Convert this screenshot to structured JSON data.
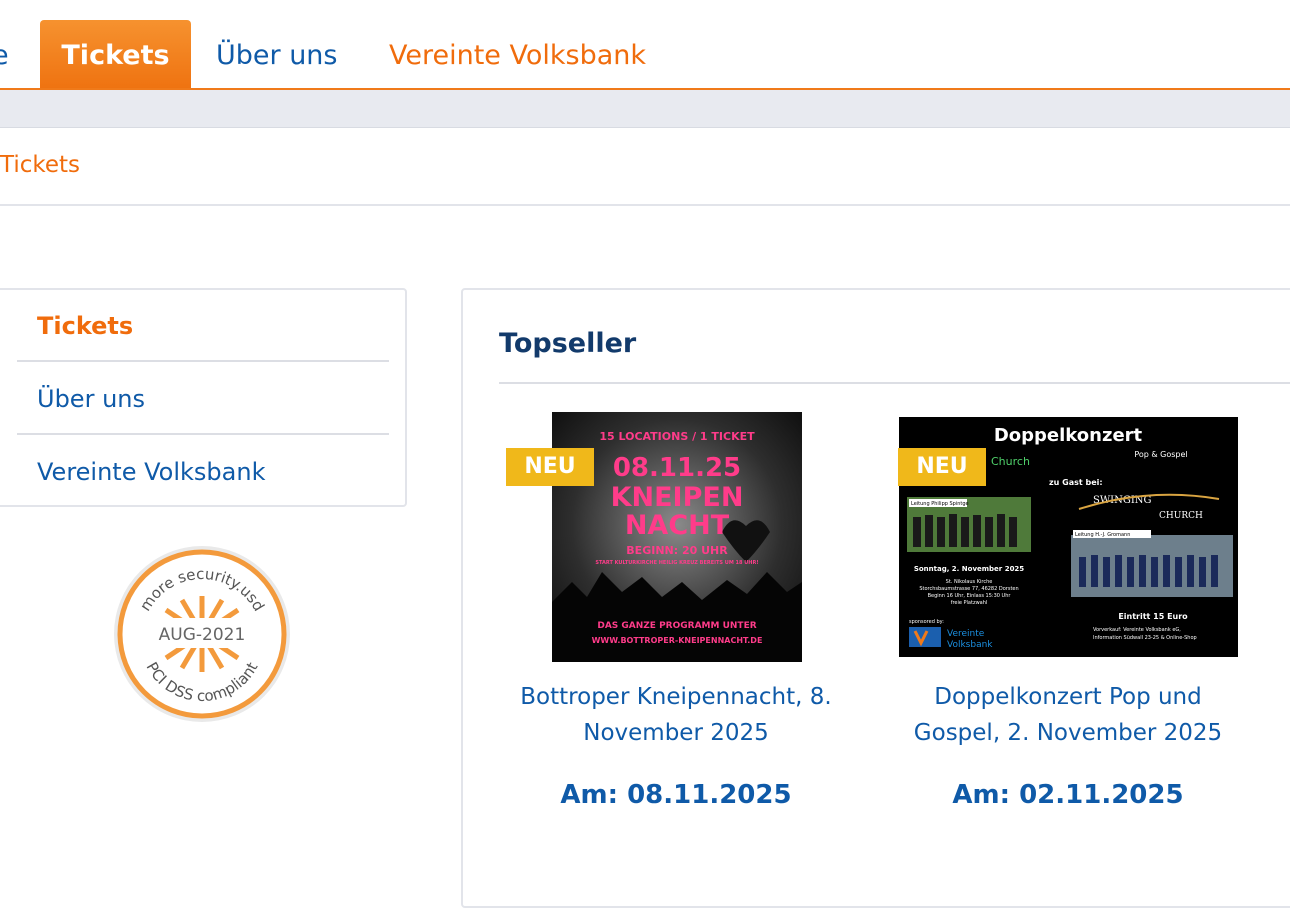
{
  "nav": {
    "cut_item": "e",
    "active": "Tickets",
    "about": "Über uns",
    "bank": "Vereinte Volksbank"
  },
  "breadcrumb": "Tickets",
  "sidebar": {
    "items": [
      {
        "label": "Tickets",
        "active": true
      },
      {
        "label": "Über uns",
        "active": false
      },
      {
        "label": "Vereinte Volksbank",
        "active": false
      }
    ]
  },
  "seal": {
    "top_text": "more security.usd",
    "date": "AUG-2021",
    "bottom_text": "PCI DSS compliant"
  },
  "main": {
    "title": "Topseller",
    "products": [
      {
        "badge": "NEU",
        "name": "Bottroper Kneipennacht, 8. November 2025",
        "date": "Am: 08.11.2025",
        "poster": {
          "line1": "15 LOCATIONS / 1 TICKET",
          "line2": "08.11.25",
          "line3": "KNEIPEN",
          "line4": "NACHT",
          "line5": "BEGINN: 20 UHR",
          "line6": "START KULTURKIRCHE HEILIG KREUZ BEREITS UM 18 UHR!",
          "line7": "DAS GANZE PROGRAMM UNTER",
          "line8": "WWW.BOTTROPER-KNEIPENNACHT.DE"
        }
      },
      {
        "badge": "NEU",
        "name": "Doppelkonzert Pop und Gospel, 2. November 2025",
        "date": "Am: 02.11.2025",
        "poster": {
          "title": "Doppelkonzert",
          "subtitle": "Pop & Gospel",
          "church": "Church",
          "guest": "zu Gast bei:",
          "swinging": "SWINGING",
          "church2": "CHURCH",
          "leader1": "Leitung Philipp Spintge",
          "leader2": "Leitung H.-J. Gromann",
          "when": "Sonntag, 2. November 2025",
          "where1": "St. Nikolaus Kirche",
          "where2": "Storchsbaumstrasse 77, 46282 Dorsten",
          "where3": "Beginn 16 Uhr, Einlass 15:30 Uhr",
          "where4": "freie Platzwahl",
          "entry": "Eintritt 15 Euro",
          "sale1": "Vorverkauf: Vereinte Volksbank eG,",
          "sale2": "Information Südwall 23-25 & Online-Shop",
          "sponsor": "sponsored by:",
          "bank1": "Vereinte",
          "bank2": "Volksbank"
        }
      }
    ]
  },
  "colors": {
    "accent": "#f07a1a",
    "link": "#0f5aa8",
    "badge": "#f0b81a"
  }
}
